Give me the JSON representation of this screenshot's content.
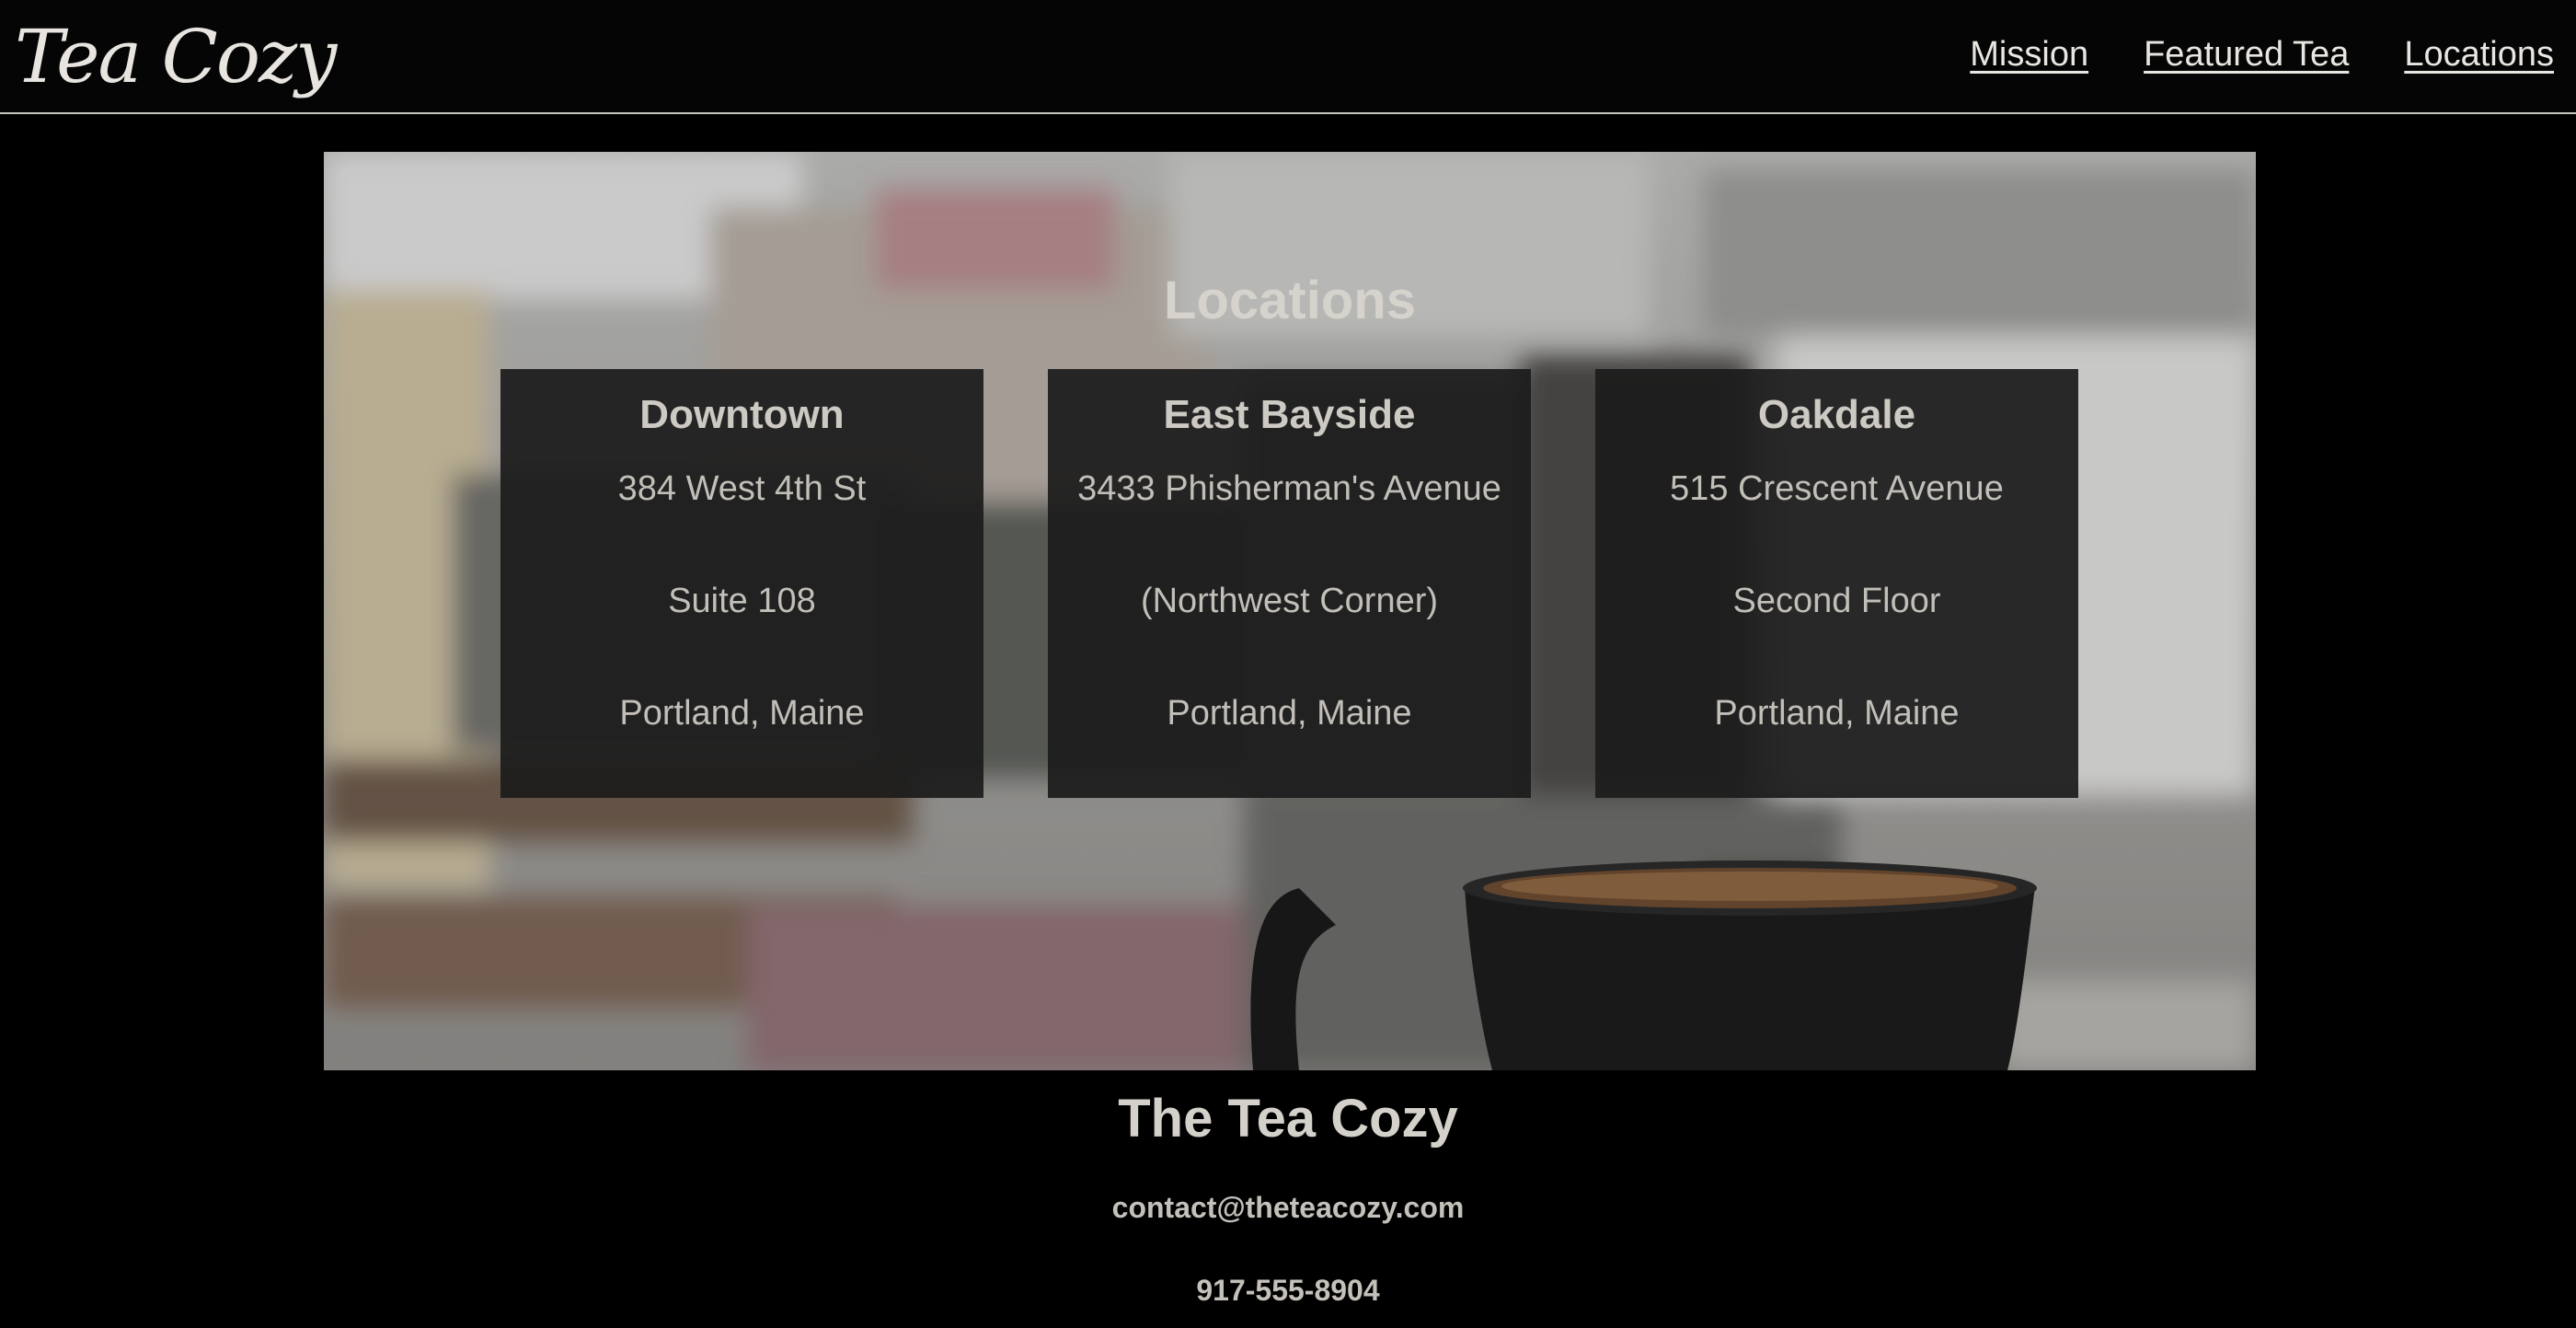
{
  "header": {
    "logo_text": "Tea Cozy",
    "nav": [
      {
        "label": "Mission"
      },
      {
        "label": "Featured Tea"
      },
      {
        "label": "Locations"
      }
    ]
  },
  "locations": {
    "title": "Locations",
    "cards": [
      {
        "name": "Downtown",
        "line1": "384 West 4th St",
        "line2": "Suite 108",
        "line3": "Portland, Maine"
      },
      {
        "name": "East Bayside",
        "line1": "3433 Phisherman's Avenue",
        "line2": "(Northwest Corner)",
        "line3": "Portland, Maine"
      },
      {
        "name": "Oakdale",
        "line1": "515 Crescent Avenue",
        "line2": "Second Floor",
        "line3": "Portland, Maine"
      }
    ]
  },
  "footer": {
    "title": "The Tea Cozy",
    "email": "contact@theteacozy.com",
    "phone": "917-555-8904"
  },
  "colors": {
    "background": "#000000",
    "text": "#d0cdc8",
    "card_bg": "#1c1c1c"
  }
}
